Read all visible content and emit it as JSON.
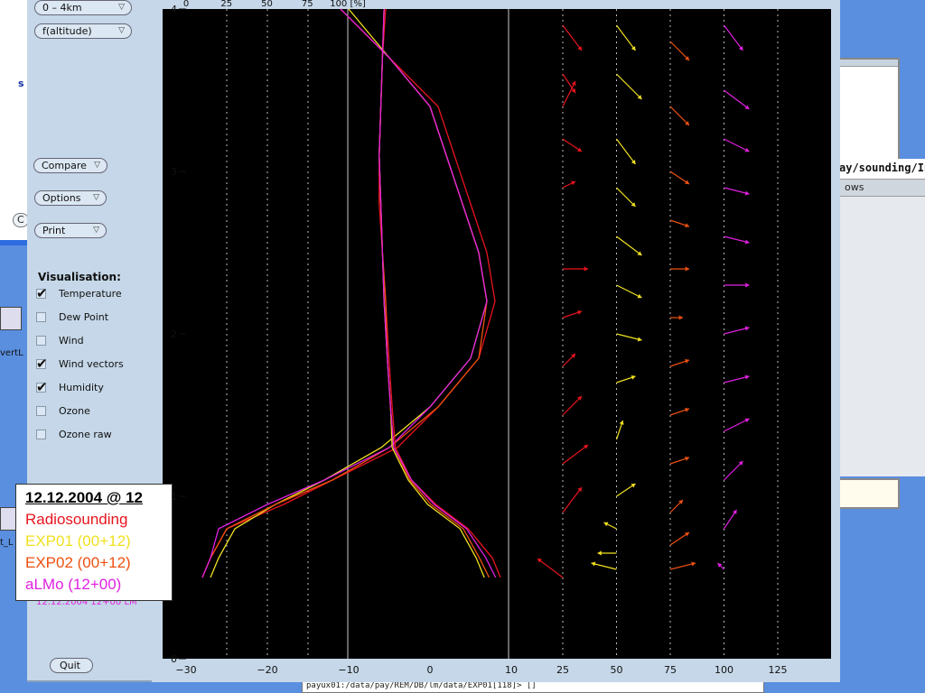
{
  "left_partial_window": {
    "s_letter": "s",
    "c_button": "C"
  },
  "desktop_icons": [
    {
      "label": "vertL"
    },
    {
      "label": "t_L"
    }
  ],
  "right_windows": {
    "title": "ay/sounding/In",
    "subtitle": "ows"
  },
  "terminal": {
    "prompt": "payux01:/data/pay/REM/DB/lm/data/EXP01[118]> []"
  },
  "side_panel": {
    "range_select": "0 – 4km",
    "axis_select": "f(altitude)",
    "compare_label": "Compare",
    "options_label": "Options",
    "print_label": "Print",
    "visualisation_title": "Visualisation:",
    "checkboxes": [
      {
        "label": "Temperature",
        "checked": true
      },
      {
        "label": "Dew Point",
        "checked": false
      },
      {
        "label": "Wind",
        "checked": false
      },
      {
        "label": "Wind vectors",
        "checked": true
      },
      {
        "label": "Humidity",
        "checked": true
      },
      {
        "label": "Ozone",
        "checked": false
      },
      {
        "label": "Ozone raw",
        "checked": false
      }
    ],
    "quit_label": "Quit",
    "status_line": "12.12.2004 12+00 LM"
  },
  "legend": {
    "title": "12.12.2004 @ 12",
    "entries": [
      {
        "label": "Radiosounding",
        "color": "#e8141e"
      },
      {
        "label": "EXP01 (00+12)",
        "color": "#f0e020"
      },
      {
        "label": "EXP02 (00+12)",
        "color": "#ee5010"
      },
      {
        "label": "aLMo (12+00)",
        "color": "#e020e0"
      }
    ]
  },
  "chart_data": {
    "type": "line",
    "y_ticks": [
      "0",
      "1",
      "2",
      "3",
      "4"
    ],
    "ylim": [
      0,
      4
    ],
    "temp_ticks": [
      "−30",
      "−20",
      "−10",
      "0",
      "10"
    ],
    "humidity_ticks": [
      "0",
      "25",
      "50",
      "75",
      "100 [%]"
    ],
    "wind_ticks": [
      "25",
      "50",
      "75",
      "100",
      "125"
    ],
    "temperature_series": [
      {
        "name": "Radiosounding",
        "color": "#e8141e",
        "x": [
          -28,
          -27,
          -25,
          -18,
          -12,
          -4,
          1,
          6,
          8,
          7,
          5,
          3,
          1,
          -5,
          -11
        ],
        "y": [
          0.5,
          0.62,
          0.8,
          0.95,
          1.1,
          1.3,
          1.55,
          1.85,
          2.2,
          2.5,
          2.8,
          3.1,
          3.4,
          3.7,
          4.0
        ]
      },
      {
        "name": "EXP01 (00+12)",
        "color": "#f0e020",
        "x": [
          -27,
          -26,
          -24,
          -19,
          -13,
          -6,
          0,
          5,
          7,
          6,
          4,
          2,
          0,
          -5,
          -10
        ],
        "y": [
          0.5,
          0.62,
          0.8,
          0.95,
          1.1,
          1.3,
          1.55,
          1.85,
          2.2,
          2.5,
          2.8,
          3.1,
          3.4,
          3.7,
          4.0
        ]
      },
      {
        "name": "EXP02 (00+12)",
        "color": "#ee5010",
        "x": [
          -28,
          -27,
          -25,
          -19,
          -12,
          -5,
          1,
          6,
          7,
          6,
          4,
          2,
          0,
          -5,
          -11
        ],
        "y": [
          0.5,
          0.62,
          0.8,
          0.95,
          1.1,
          1.3,
          1.55,
          1.85,
          2.2,
          2.5,
          2.8,
          3.1,
          3.4,
          3.7,
          4.0
        ]
      },
      {
        "name": "aLMo (12+00)",
        "color": "#e020e0",
        "x": [
          -28,
          -27,
          -26,
          -20,
          -13,
          -5,
          0,
          5,
          7,
          6,
          4,
          2,
          0,
          -5,
          -11
        ],
        "y": [
          0.5,
          0.62,
          0.8,
          0.95,
          1.1,
          1.3,
          1.55,
          1.85,
          2.2,
          2.5,
          2.8,
          3.1,
          3.4,
          3.7,
          4.0
        ]
      }
    ],
    "humidity_series": [
      {
        "name": "Radiosounding",
        "color": "#e8141e",
        "x": [
          95,
          90,
          75,
          55,
          40,
          30,
          28,
          26,
          24,
          22,
          20,
          20,
          21,
          22,
          24
        ],
        "y": [
          0.5,
          0.62,
          0.8,
          0.95,
          1.1,
          1.3,
          1.55,
          1.85,
          2.2,
          2.5,
          2.8,
          3.1,
          3.4,
          3.7,
          4.0
        ]
      },
      {
        "name": "EXP01 (00+12)",
        "color": "#f0e020",
        "x": [
          85,
          80,
          70,
          50,
          38,
          28,
          27,
          25,
          23,
          22,
          21,
          20,
          21,
          22,
          23
        ],
        "y": [
          0.5,
          0.62,
          0.8,
          0.95,
          1.1,
          1.3,
          1.55,
          1.85,
          2.2,
          2.5,
          2.8,
          3.1,
          3.4,
          3.7,
          4.0
        ]
      },
      {
        "name": "EXP02 (00+12)",
        "color": "#ee5010",
        "x": [
          88,
          82,
          72,
          52,
          39,
          29,
          27,
          25,
          24,
          22,
          21,
          20,
          21,
          22,
          23
        ],
        "y": [
          0.5,
          0.62,
          0.8,
          0.95,
          1.1,
          1.3,
          1.55,
          1.85,
          2.2,
          2.5,
          2.8,
          3.1,
          3.4,
          3.7,
          4.0
        ]
      },
      {
        "name": "aLMo (12+00)",
        "color": "#e020e0",
        "x": [
          92,
          86,
          74,
          54,
          40,
          29,
          27,
          25,
          23,
          22,
          21,
          20,
          21,
          22,
          23
        ],
        "y": [
          0.5,
          0.62,
          0.8,
          0.95,
          1.1,
          1.3,
          1.55,
          1.85,
          2.2,
          2.5,
          2.8,
          3.1,
          3.4,
          3.7,
          4.0
        ]
      }
    ],
    "wind_vectors": [
      {
        "name": "Radiosounding",
        "color": "#e8141e",
        "base_x": 25,
        "u": [
          -4,
          3,
          4,
          3,
          2,
          3,
          4,
          2,
          3,
          2,
          3,
          2
        ],
        "v": [
          3,
          4,
          3,
          3,
          2,
          1,
          0,
          1,
          -2,
          -3,
          -4,
          4
        ],
        "y": [
          0.5,
          0.9,
          1.2,
          1.5,
          1.8,
          2.1,
          2.4,
          2.9,
          3.2,
          3.6,
          3.9,
          3.4
        ]
      },
      {
        "name": "EXP01 (00+12)",
        "color": "#f0e020",
        "base_x": 50,
        "u": [
          -4,
          -3,
          -2,
          3,
          1,
          3,
          4,
          4,
          4,
          3,
          3,
          4,
          3
        ],
        "v": [
          1,
          0,
          1,
          2,
          3,
          1,
          -1,
          -2,
          -3,
          -3,
          -4,
          -4,
          -4
        ],
        "y": [
          0.55,
          0.65,
          0.8,
          1.0,
          1.35,
          1.7,
          2.0,
          2.3,
          2.6,
          2.9,
          3.2,
          3.6,
          3.9
        ]
      },
      {
        "name": "EXP02 (00+12)",
        "color": "#ee5010",
        "base_x": 75,
        "u": [
          4,
          3,
          2,
          3,
          3,
          3,
          2,
          3,
          3,
          3,
          3,
          3
        ],
        "v": [
          1,
          2,
          2,
          1,
          1,
          1,
          0,
          0,
          -1,
          -2,
          -3,
          -3
        ],
        "y": [
          0.55,
          0.7,
          0.9,
          1.2,
          1.5,
          1.8,
          2.1,
          2.4,
          2.7,
          3.0,
          3.4,
          3.8
        ]
      },
      {
        "name": "aLMo (12+00)",
        "color": "#e020e0",
        "base_x": 100,
        "u": [
          -1,
          2,
          3,
          4,
          4,
          4,
          4,
          4,
          4,
          4,
          4,
          3
        ],
        "v": [
          1,
          3,
          3,
          2,
          1,
          1,
          0,
          -1,
          -1,
          -2,
          -3,
          -4
        ],
        "y": [
          0.55,
          0.8,
          1.1,
          1.4,
          1.7,
          2.0,
          2.3,
          2.6,
          2.9,
          3.2,
          3.5,
          3.9
        ]
      }
    ]
  }
}
